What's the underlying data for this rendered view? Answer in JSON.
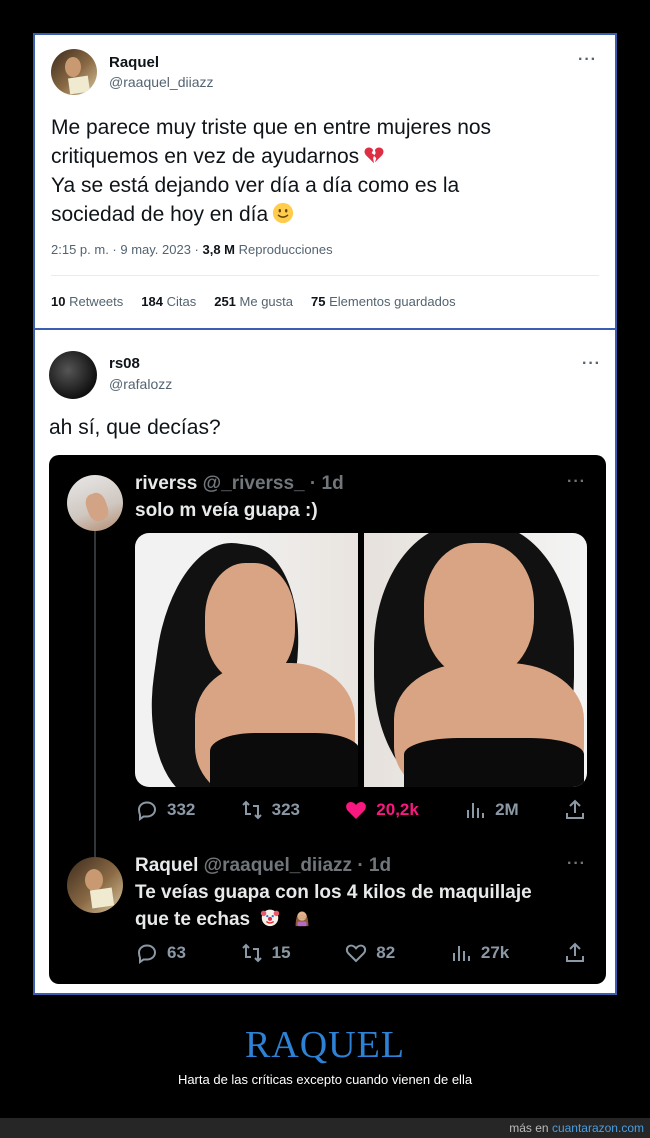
{
  "tweet": {
    "name": "Raquel",
    "handle": "@raaquel_diiazz",
    "text_lines": [
      "Me parece muy triste que en entre mujeres nos",
      "critiquemos en vez de ayudarnos",
      "Ya se está dejando ver día a día como es la",
      "sociedad de hoy en día"
    ],
    "emoji_1": "broken-heart-icon",
    "emoji_2": "slight-smile-icon",
    "timestamp": "2:15 p. m. · 9 may. 2023 · ",
    "views_count": "3,8 M",
    "views_label": " Reproducciones",
    "stats": [
      {
        "count": "10",
        "label": " Retweets"
      },
      {
        "count": "184",
        "label": " Citas"
      },
      {
        "count": "251",
        "label": " Me gusta"
      },
      {
        "count": "75",
        "label": " Elementos guardados"
      }
    ]
  },
  "reply": {
    "name": "rs08",
    "handle": "@rafalozz",
    "text": "ah sí, que decías?"
  },
  "embed": {
    "post1": {
      "name": "riverss",
      "handle": " @_riverss_ · 1d",
      "text": "solo m veía guapa :)",
      "replies": "332",
      "retweets": "323",
      "likes": "20,2k",
      "views": "2M"
    },
    "post2": {
      "name": "Raquel",
      "handle": " @raaquel_diiazz · 1d",
      "text_line1": "Te veías guapa con los 4 kilos de maquillaje",
      "text_line2": "que te echas",
      "emojis": [
        "clown-face-icon",
        "woman-facepalming-icon"
      ],
      "replies": "63",
      "retweets": "15",
      "likes": "82",
      "views": "27k"
    }
  },
  "footer": {
    "title": "RAQUEL",
    "subtitle": "Harta de las críticas excepto cuando vienen de ella",
    "credit_prefix": "más en ",
    "credit_site": "cuantarazon.com"
  },
  "colors": {
    "frame_border": "#3a5fb0",
    "title_blue": "#2e82d6",
    "like_pink": "#f91880"
  }
}
